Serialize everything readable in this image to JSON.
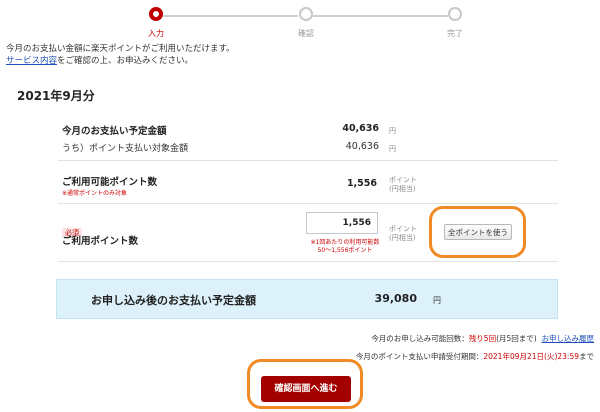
{
  "stepper": {
    "steps": [
      {
        "label": "入力"
      },
      {
        "label": "確認"
      },
      {
        "label": "完了"
      }
    ]
  },
  "intro": {
    "line1": "今月のお支払い金額に楽天ポイントがご利用いただけます。",
    "service_link": "サービス内容",
    "line2_rest": "をご確認の上、お申込みください。"
  },
  "period": "2021年9月分",
  "rows": {
    "scheduled_payment": {
      "label": "今月のお支払い予定金額",
      "value": "40,636",
      "unit": "円"
    },
    "point_target": {
      "label": "うち）ポイント支払い対象金額",
      "value": "40,636",
      "unit": "円"
    },
    "available_points": {
      "label": "ご利用可能ポイント数",
      "note": "※通常ポイントのみ対象",
      "value": "1,556",
      "unit1": "ポイント",
      "unit2": "(円相当)"
    },
    "use_points": {
      "badge": "必須",
      "label": "ご利用ポイント数",
      "input_value": "1,556",
      "note1": "※1回あたりの利用可能数",
      "note2": "50〜1,556ポイント",
      "unit1": "ポイント",
      "unit2": "(円相当)",
      "use_all_label": "全ポイントを使う"
    }
  },
  "summary": {
    "label": "お申し込み後のお支払い予定金額",
    "value": "39,080",
    "unit": "円"
  },
  "footer": {
    "remaining_prefix": "今月のお申し込み可能回数：",
    "remaining_value": "残り5回",
    "remaining_suffix": "(月5回まで)",
    "history_link": "お申し込み履歴",
    "deadline_prefix": "今月のポイント支払い申請受付期間：",
    "deadline_value": "2021年09月21日(火)23:59",
    "deadline_suffix": "まで"
  },
  "confirm_button": "確認画面へ進む",
  "colors": {
    "accent": "#bf0000",
    "highlight_ring": "#f08a24",
    "summary_bg": "#dcf1fa",
    "link": "#1f4fb8"
  }
}
